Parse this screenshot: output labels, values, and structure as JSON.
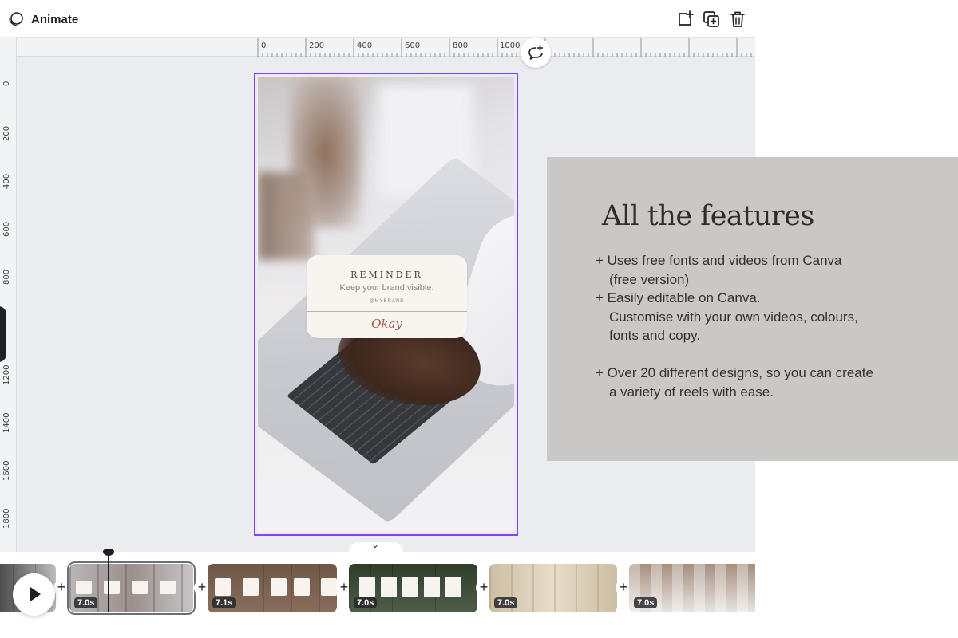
{
  "toolbar": {
    "title": "Animate",
    "icons": [
      "animate-icon",
      "add-page-icon",
      "duplicate-page-icon",
      "trash-icon"
    ]
  },
  "rulers": {
    "horizontal_ticks": [
      "0",
      "200",
      "400",
      "600",
      "800",
      "1000"
    ],
    "vertical_ticks": [
      "0",
      "200",
      "400",
      "600",
      "800",
      "1200",
      "1400",
      "1600",
      "1800"
    ]
  },
  "design": {
    "card": {
      "title": "REMINDER",
      "subtitle": "Keep your brand visible.",
      "handle": "@MYBRAND",
      "button": "Okay"
    }
  },
  "feature_panel": {
    "title": "All the features",
    "items": [
      "+ Uses free fonts and videos from Canva\n(free version)",
      "+ Easily editable on Canva.\nCustomise with your own videos, colours,\nfonts and copy.",
      "+ Over 20 different designs, so you can create\na variety of reels with ease."
    ]
  },
  "timeline": {
    "clips": [
      {
        "duration": ""
      },
      {
        "duration": "7.0s",
        "selected": true
      },
      {
        "duration": "7.1s"
      },
      {
        "duration": "7.0s"
      },
      {
        "duration": "7.0s"
      },
      {
        "duration": "7.0s"
      }
    ],
    "add_label": "+",
    "collapse_label": "⌄"
  },
  "colors": {
    "selection": "#8b3dff",
    "panel_bg": "#cac8c6",
    "workspace_bg": "#ebecf0"
  }
}
